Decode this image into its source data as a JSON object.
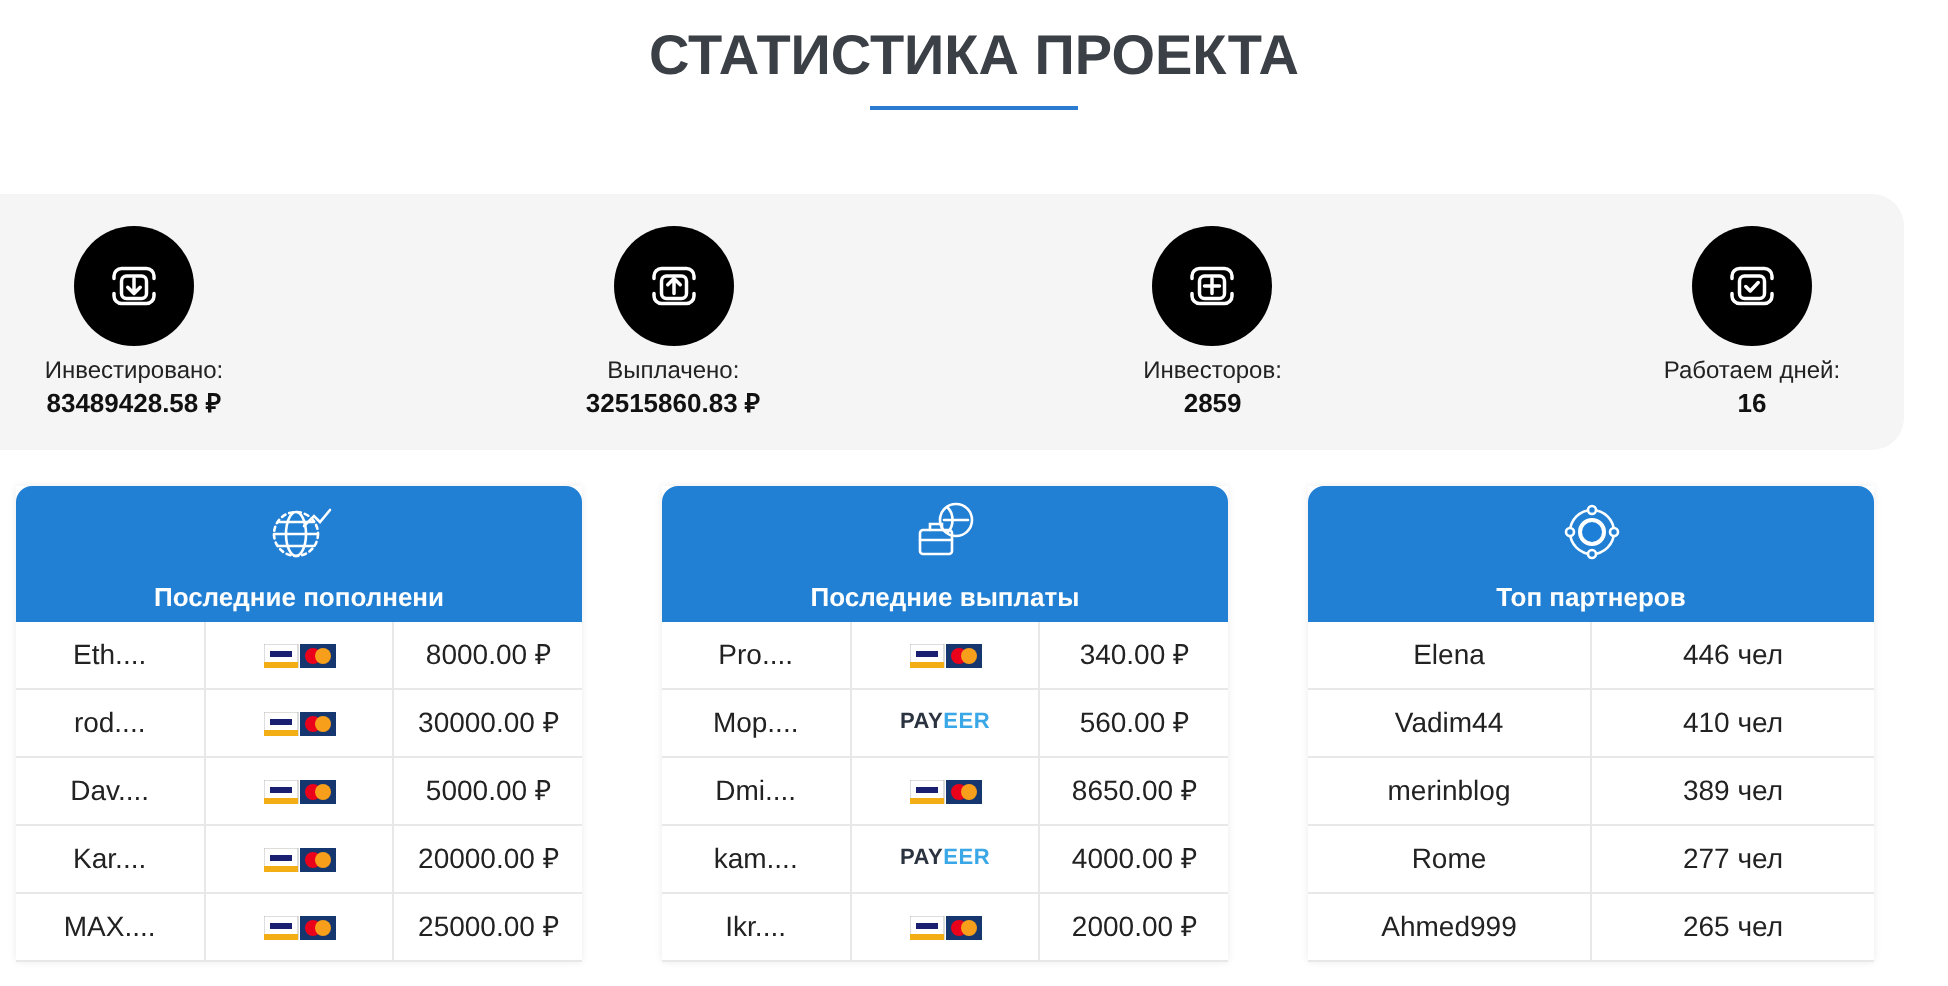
{
  "title": "СТАТИСТИКА ПРОЕКТА",
  "stats": [
    {
      "kind": "down",
      "label": "Инвестировано:",
      "value": "83489428.58 ₽"
    },
    {
      "kind": "up",
      "label": "Выплачено:",
      "value": "32515860.83 ₽"
    },
    {
      "kind": "plus",
      "label": "Инвесторов:",
      "value": "2859"
    },
    {
      "kind": "check",
      "label": "Работаем дней:",
      "value": "16"
    }
  ],
  "tables": [
    {
      "kind": "globe",
      "title": "Последние пополнени",
      "rows": [
        {
          "name": "Eth....",
          "method": {
            "kind": "card"
          },
          "amount": "8000.00 ₽"
        },
        {
          "name": "rod....",
          "method": {
            "kind": "card"
          },
          "amount": "30000.00 ₽"
        },
        {
          "name": "Dav....",
          "method": {
            "kind": "card"
          },
          "amount": "5000.00 ₽"
        },
        {
          "name": "Kar....",
          "method": {
            "kind": "card"
          },
          "amount": "20000.00 ₽"
        },
        {
          "name": "MAX....",
          "method": {
            "kind": "card"
          },
          "amount": "25000.00 ₽"
        }
      ]
    },
    {
      "kind": "wallet",
      "title": "Последние выплаты",
      "rows": [
        {
          "name": "Pro....",
          "method": {
            "kind": "card"
          },
          "amount": "340.00 ₽"
        },
        {
          "name": "Mop....",
          "method": {
            "kind": "payeer",
            "part_a": "PAY",
            "part_b": "EER"
          },
          "amount": "560.00 ₽"
        },
        {
          "name": "Dmi....",
          "method": {
            "kind": "card"
          },
          "amount": "8650.00 ₽"
        },
        {
          "name": "kam....",
          "method": {
            "kind": "payeer",
            "part_a": "PAY",
            "part_b": "EER"
          },
          "amount": "4000.00 ₽"
        },
        {
          "name": "Ikr....",
          "method": {
            "kind": "card"
          },
          "amount": "2000.00 ₽"
        }
      ]
    },
    {
      "kind": "network",
      "title": "Топ партнеров",
      "rows": [
        {
          "name": "Elena",
          "count": "446 чел"
        },
        {
          "name": "Vadim44",
          "count": "410 чел"
        },
        {
          "name": "merinblog",
          "count": "389 чел"
        },
        {
          "name": "Rome",
          "count": "277 чел"
        },
        {
          "name": "Ahmed999",
          "count": "265 чел"
        }
      ]
    }
  ]
}
